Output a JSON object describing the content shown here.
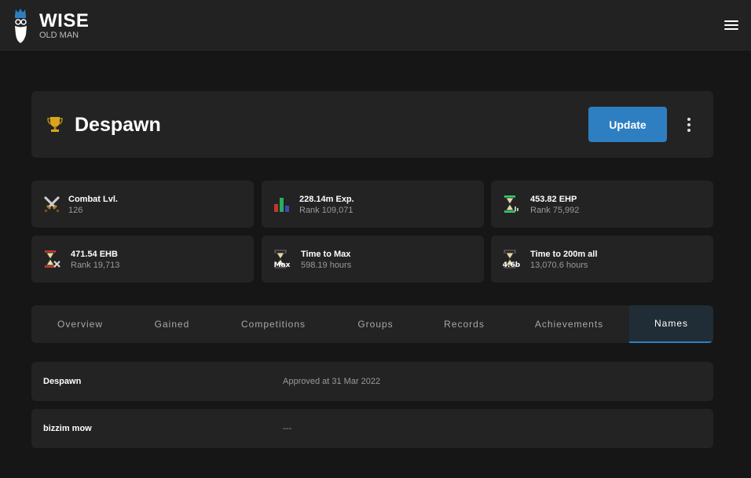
{
  "app": {
    "logo_title": "WISE",
    "logo_subtitle": "OLD MAN"
  },
  "player": {
    "name": "Despawn",
    "update_label": "Update"
  },
  "stats": [
    {
      "icon": "combat-swords-icon",
      "label": "Combat Lvl.",
      "value": "126"
    },
    {
      "icon": "experience-chart-icon",
      "label": "228.14m Exp.",
      "value": "Rank 109,071"
    },
    {
      "icon": "ehp-hourglass-icon",
      "label": "453.82 EHP",
      "value": "Rank 75,992"
    },
    {
      "icon": "ehb-hourglass-icon",
      "label": "471.54 EHB",
      "value": "Rank 19,713"
    },
    {
      "icon": "time-to-max-icon",
      "icon_text": "Max",
      "label": "Time to Max",
      "value": "598.19 hours"
    },
    {
      "icon": "time-to-200m-icon",
      "icon_text": "4.6b",
      "label": "Time to 200m all",
      "value": "13,070.6 hours"
    }
  ],
  "tabs": [
    {
      "label": "Overview",
      "active": false
    },
    {
      "label": "Gained",
      "active": false
    },
    {
      "label": "Competitions",
      "active": false
    },
    {
      "label": "Groups",
      "active": false
    },
    {
      "label": "Records",
      "active": false
    },
    {
      "label": "Achievements",
      "active": false
    },
    {
      "label": "Names",
      "active": true
    }
  ],
  "names": [
    {
      "name": "Despawn",
      "detail": "Approved at 31 Mar 2022"
    },
    {
      "name": "bizzim mow",
      "detail": "---"
    }
  ],
  "colors": {
    "accent": "#2e7fc1",
    "background": "#161616",
    "card": "#232323",
    "topbar": "#222222"
  }
}
